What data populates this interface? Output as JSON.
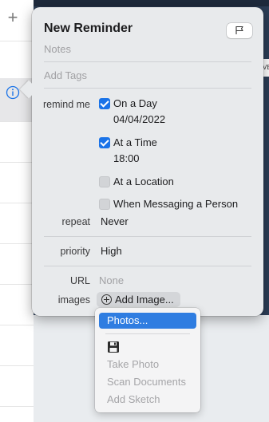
{
  "reminder": {
    "title": "New Reminder",
    "notes_placeholder": "Notes",
    "tags_placeholder": "Add Tags"
  },
  "remind_me": {
    "label": "remind me",
    "on_a_day": {
      "label": "On a Day",
      "checked": true,
      "date": "04/04/2022"
    },
    "at_a_time": {
      "label": "At a Time",
      "checked": true,
      "time": "18:00"
    },
    "at_a_location": {
      "label": "At a Location",
      "checked": false
    },
    "when_messaging": {
      "label": "When Messaging a Person",
      "checked": false
    }
  },
  "repeat": {
    "label": "repeat",
    "value": "Never"
  },
  "priority": {
    "label": "priority",
    "value": "High"
  },
  "url": {
    "label": "URL",
    "placeholder": "None"
  },
  "images": {
    "label": "images",
    "button": "Add Image..."
  },
  "image_menu": {
    "items": [
      {
        "label": "Photos...",
        "selected": true,
        "enabled": true
      },
      {
        "label": "Take Photo",
        "enabled": false
      },
      {
        "label": "Scan Documents",
        "enabled": false
      },
      {
        "label": "Add Sketch",
        "enabled": false
      }
    ],
    "icon": "floppy-disk-icon"
  },
  "background": {
    "peek_text": "VE"
  },
  "colors": {
    "accent": "#1a73e8",
    "menu_highlight": "#2f7de1",
    "popover_bg": "#e8eaec",
    "background_app": "#2c3e57"
  }
}
